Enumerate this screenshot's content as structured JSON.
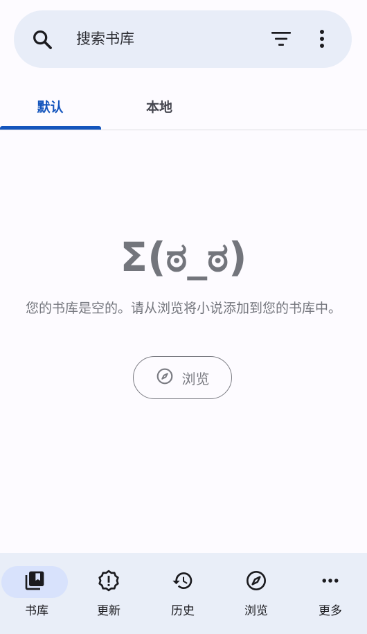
{
  "search": {
    "placeholder": "搜索书库"
  },
  "tabs": [
    {
      "label": "默认",
      "active": true
    },
    {
      "label": "本地",
      "active": false
    }
  ],
  "empty_state": {
    "face": "Σ(ಠ_ಠ)",
    "message": "您的书库是空的。请从浏览将小说添加到您的书库中。",
    "button_label": "浏览"
  },
  "bottom_nav": [
    {
      "label": "书库",
      "icon": "library-icon",
      "active": true
    },
    {
      "label": "更新",
      "icon": "updates-icon",
      "active": false
    },
    {
      "label": "历史",
      "icon": "history-icon",
      "active": false
    },
    {
      "label": "浏览",
      "icon": "compass-icon",
      "active": false
    },
    {
      "label": "更多",
      "icon": "more-horiz-icon",
      "active": false
    }
  ],
  "colors": {
    "accent": "#1455bd",
    "search_bg": "#e8edf8",
    "nav_bg": "#e9eef8",
    "active_pill": "#d8e2fc",
    "muted_text": "#74767d"
  }
}
